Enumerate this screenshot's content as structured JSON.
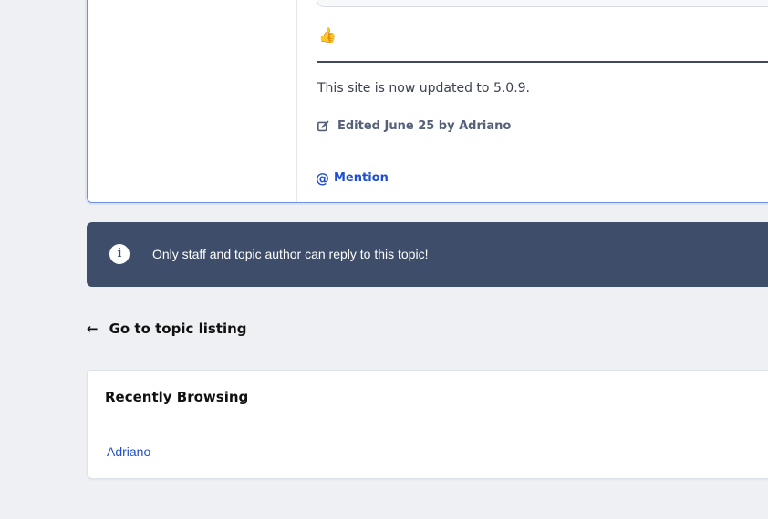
{
  "post": {
    "reaction_emoji": "👍",
    "body_text": "This site is now updated to 5.0.9.",
    "edited_text": "Edited June 25 by Adriano",
    "mention_label": "Mention",
    "mention_symbol": "@"
  },
  "notice": {
    "icon_glyph": "i",
    "text": "Only staff and topic author can reply to this topic!"
  },
  "navigation": {
    "back_arrow": "←",
    "back_label": "Go to topic listing"
  },
  "recently_browsing": {
    "title": "Recently Browsing",
    "users": [
      "Adriano"
    ]
  },
  "colors": {
    "page_background": "#eef0f4",
    "notice_background": "#3e4e6a",
    "link_blue": "#1f4fd0",
    "card_border_active": "#6f8fe0"
  }
}
